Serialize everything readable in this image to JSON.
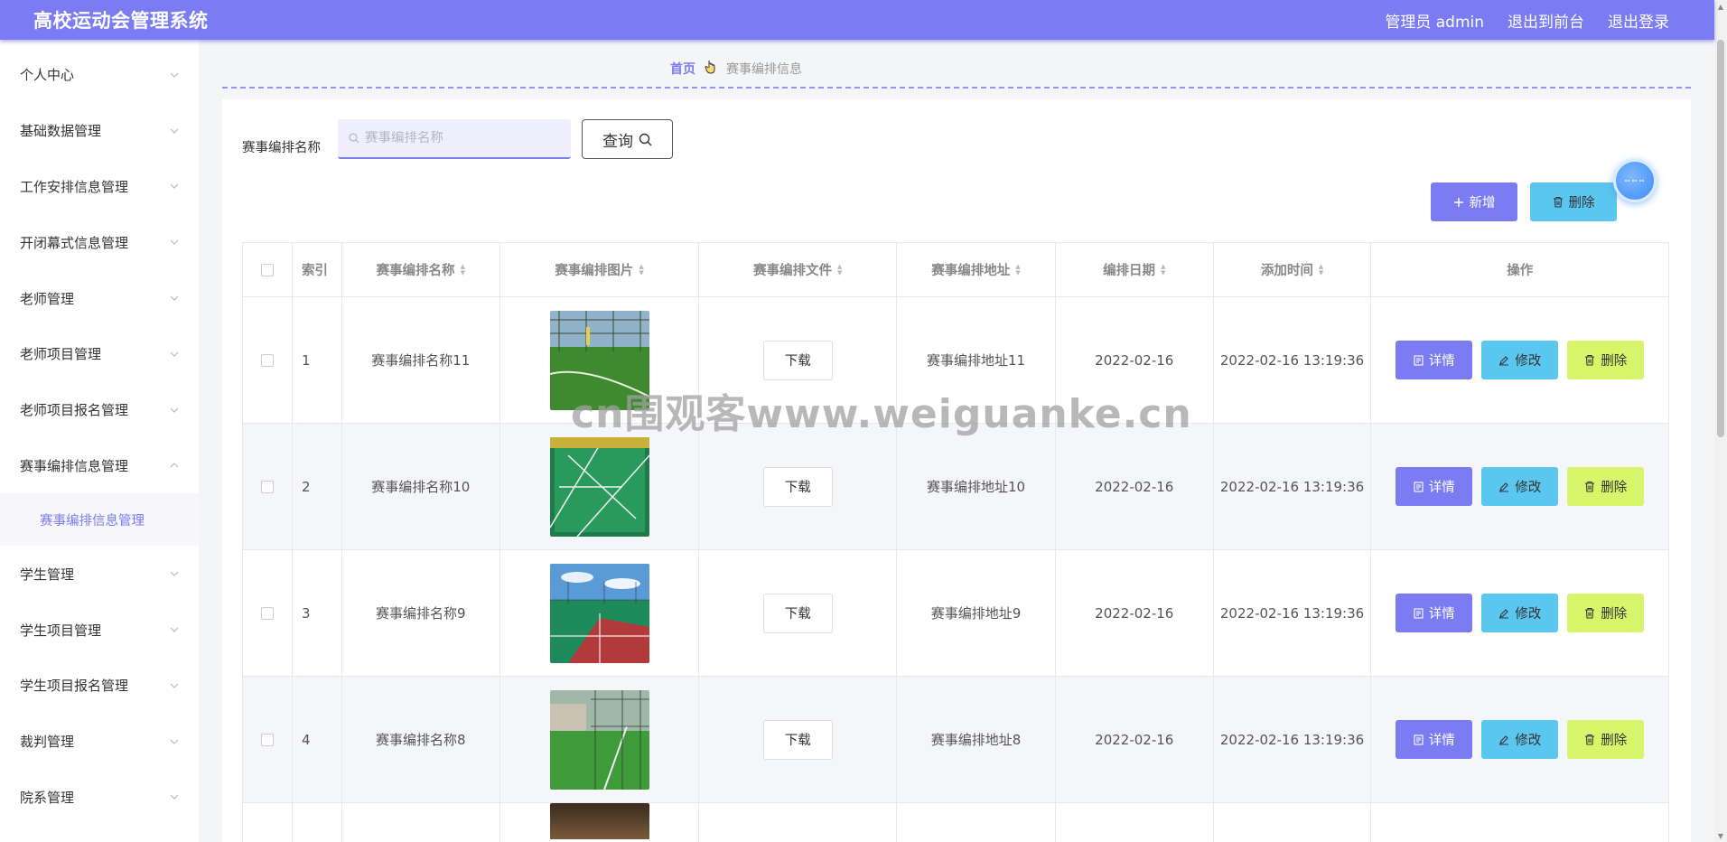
{
  "header": {
    "title": "高校运动会管理系统",
    "user": "管理员 admin",
    "to_front": "退出到前台",
    "logout": "退出登录"
  },
  "sidebar": {
    "items": [
      {
        "label": "个人中心",
        "expanded": false
      },
      {
        "label": "基础数据管理",
        "expanded": false
      },
      {
        "label": "工作安排信息管理",
        "expanded": false
      },
      {
        "label": "开闭幕式信息管理",
        "expanded": false
      },
      {
        "label": "老师管理",
        "expanded": false
      },
      {
        "label": "老师项目管理",
        "expanded": false
      },
      {
        "label": "老师项目报名管理",
        "expanded": false
      },
      {
        "label": "赛事编排信息管理",
        "expanded": true
      },
      {
        "label": "学生管理",
        "expanded": false
      },
      {
        "label": "学生项目管理",
        "expanded": false
      },
      {
        "label": "学生项目报名管理",
        "expanded": false
      },
      {
        "label": "裁判管理",
        "expanded": false
      },
      {
        "label": "院系管理",
        "expanded": false
      }
    ],
    "active_sub": "赛事编排信息管理"
  },
  "breadcrumb": {
    "home": "首页",
    "current": "赛事编排信息"
  },
  "search": {
    "label": "赛事编排名称",
    "placeholder": "赛事编排名称",
    "query_label": "查询"
  },
  "toolbar": {
    "add_label": "新增",
    "delete_label": "删除"
  },
  "table": {
    "headers": [
      "索引",
      "赛事编排名称",
      "赛事编排图片",
      "赛事编排文件",
      "赛事编排地址",
      "编排日期",
      "添加时间",
      "操作"
    ],
    "download_label": "下载",
    "actions": {
      "detail": "详情",
      "edit": "修改",
      "delete": "删除"
    },
    "rows": [
      {
        "index": "1",
        "name": "赛事编排名称11",
        "address": "赛事编排地址11",
        "date": "2022-02-16",
        "added": "2022-02-16 13:19:36"
      },
      {
        "index": "2",
        "name": "赛事编排名称10",
        "address": "赛事编排地址10",
        "date": "2022-02-16",
        "added": "2022-02-16 13:19:36"
      },
      {
        "index": "3",
        "name": "赛事编排名称9",
        "address": "赛事编排地址9",
        "date": "2022-02-16",
        "added": "2022-02-16 13:19:36"
      },
      {
        "index": "4",
        "name": "赛事编排名称8",
        "address": "赛事编排地址8",
        "date": "2022-02-16",
        "added": "2022-02-16 13:19:36"
      }
    ]
  },
  "watermark": "cn围观客www.weiguanke.cn",
  "colors": {
    "primary": "#7b7cf2",
    "info": "#5bc6ef",
    "danger_alt": "#d7f56a"
  }
}
